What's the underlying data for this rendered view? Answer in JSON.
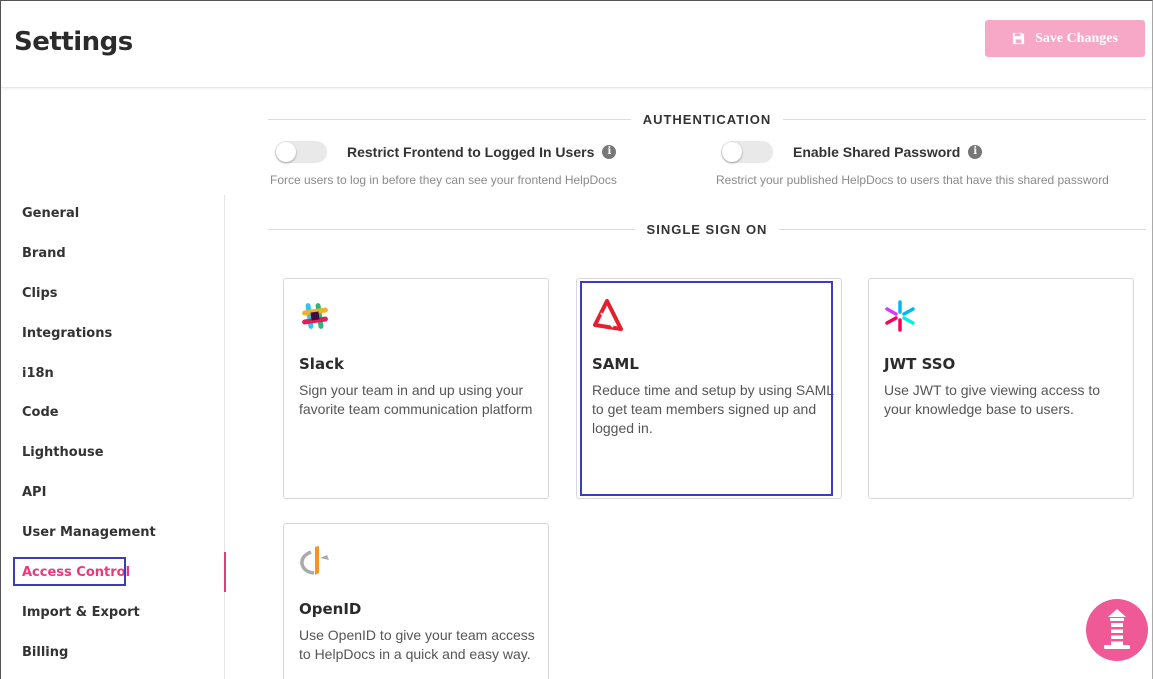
{
  "header": {
    "title": "Settings",
    "save_label": "Save Changes"
  },
  "sidebar": {
    "items": [
      {
        "label": "General"
      },
      {
        "label": "Brand"
      },
      {
        "label": "Clips"
      },
      {
        "label": "Integrations"
      },
      {
        "label": "i18n"
      },
      {
        "label": "Code"
      },
      {
        "label": "Lighthouse"
      },
      {
        "label": "API"
      },
      {
        "label": "User Management"
      },
      {
        "label": "Access Control",
        "active": true
      },
      {
        "label": "Import & Export"
      },
      {
        "label": "Billing"
      }
    ]
  },
  "authentication": {
    "heading": "AUTHENTICATION",
    "restrict_frontend": {
      "label": "Restrict Frontend to Logged In Users",
      "description": "Force users to log in before they can see your frontend HelpDocs",
      "enabled": false
    },
    "shared_password": {
      "label": "Enable Shared Password",
      "description": "Restrict your published HelpDocs to users that have this shared password",
      "enabled": false
    }
  },
  "sso": {
    "heading": "SINGLE SIGN ON",
    "cards": [
      {
        "title": "Slack",
        "description": "Sign your team in and up using your favorite team communication platform",
        "icon": "slack-icon"
      },
      {
        "title": "SAML",
        "description": "Reduce time and setup by using SAML to get team members signed up and logged in.",
        "icon": "saml-icon"
      },
      {
        "title": "JWT SSO",
        "description": "Use JWT to give viewing access to your knowledge base to users.",
        "icon": "jwt-icon"
      },
      {
        "title": "OpenID",
        "description": "Use OpenID to give your team access to HelpDocs in a quick and easy way.",
        "icon": "openid-icon"
      }
    ]
  },
  "colors": {
    "accent": "#e8397c",
    "save_button": "#f7a8c6",
    "highlight": "#3b3dbf"
  }
}
